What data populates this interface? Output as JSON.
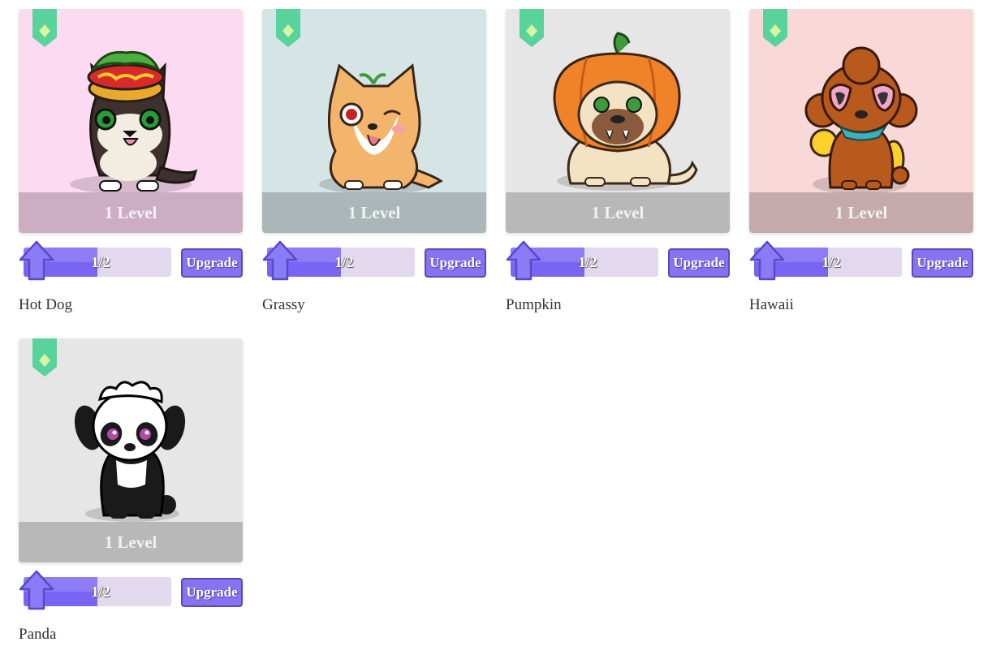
{
  "pets": [
    {
      "name": "Hot Dog",
      "level_label": "1 Level",
      "progress_text": "1/2",
      "progress": 0.5,
      "upgrade_label": "Upgrade",
      "bg": "#fcdaf1",
      "bar": "#ccadc4",
      "art": "hotdog"
    },
    {
      "name": "Grassy",
      "level_label": "1 Level",
      "progress_text": "1/2",
      "progress": 0.5,
      "upgrade_label": "Upgrade",
      "bg": "#d5e4e5",
      "bar": "#aab6b7",
      "art": "corgi"
    },
    {
      "name": "Pumpkin",
      "level_label": "1 Level",
      "progress_text": "1/2",
      "progress": 0.5,
      "upgrade_label": "Upgrade",
      "bg": "#e6e6e6",
      "bar": "#b8b8b8",
      "art": "pumpkin"
    },
    {
      "name": "Hawaii",
      "level_label": "1 Level",
      "progress_text": "1/2",
      "progress": 0.5,
      "upgrade_label": "Upgrade",
      "bg": "#f8d9d8",
      "bar": "#c6aaab",
      "art": "poodle"
    },
    {
      "name": "Panda",
      "level_label": "1 Level",
      "progress_text": "1/2",
      "progress": 0.5,
      "upgrade_label": "Upgrade",
      "bg": "#e6e6e6",
      "bar": "#b8b8b8",
      "art": "panda"
    }
  ],
  "colors": {
    "ribbon": "#59d39c",
    "ribbon_gem": "#d8f5a0",
    "progress_fill": "#7a64f4",
    "progress_track": "#e3d9ef",
    "upgrade_button": "#8673f0"
  }
}
